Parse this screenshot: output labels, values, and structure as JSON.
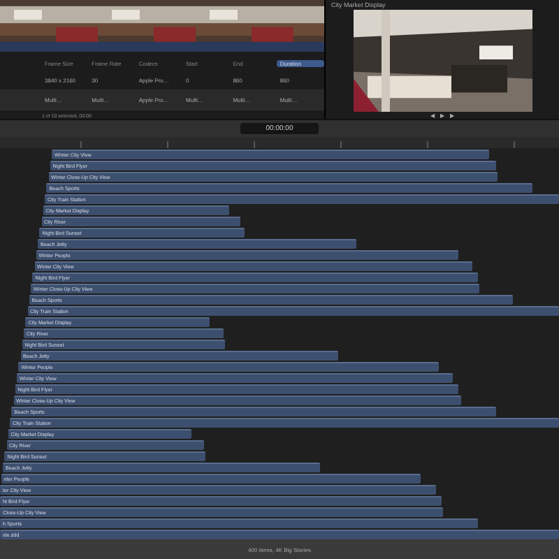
{
  "browser": {
    "columns": [
      {
        "label": "Frame Size",
        "selected": false
      },
      {
        "label": "Frame Rate",
        "selected": false
      },
      {
        "label": "Codecs",
        "selected": false
      },
      {
        "label": "Start",
        "selected": false
      },
      {
        "label": "End",
        "selected": false
      },
      {
        "label": "Duration",
        "selected": true
      }
    ],
    "rows": [
      [
        "3840 x 2160",
        "30",
        "Apple Pro…",
        "0",
        "860",
        "860"
      ],
      [
        "Multi…",
        "Multi…",
        "Apple Pro…",
        "Multi…",
        "Multi…",
        "Multi…"
      ]
    ],
    "selection_info": "1 of 10 selected, 00:00"
  },
  "viewer": {
    "title": "City Market Display",
    "controls": [
      "◀",
      "▶",
      "▶"
    ]
  },
  "toolbar": {
    "timecode": "00:00:00"
  },
  "clips": [
    {
      "name": "Winter City View"
    },
    {
      "name": "Night Bird Flyer"
    },
    {
      "name": "Winter Close-Up City View"
    },
    {
      "name": "Beach Sports"
    },
    {
      "name": "City Train Station"
    },
    {
      "name": "City Market Display"
    },
    {
      "name": "City River"
    },
    {
      "name": "Night Bird Sunset"
    },
    {
      "name": "Beach Jetty"
    },
    {
      "name": "Winter People"
    },
    {
      "name": "Winter City View"
    },
    {
      "name": "Night Bird Flyer"
    },
    {
      "name": "Winter Close-Up City View"
    },
    {
      "name": "Beach Sports"
    },
    {
      "name": "City Train Station"
    },
    {
      "name": "City Market Display"
    },
    {
      "name": "City River"
    },
    {
      "name": "Night Bird Sunset"
    },
    {
      "name": "Beach Jetty"
    },
    {
      "name": "Winter People"
    },
    {
      "name": "Winter City View"
    },
    {
      "name": "Night Bird Flyer"
    },
    {
      "name": "Winter Close-Up City View"
    },
    {
      "name": "Beach Sports"
    },
    {
      "name": "City Train Station"
    },
    {
      "name": "City Market Display"
    },
    {
      "name": "City River"
    },
    {
      "name": "Night Bird Sunset"
    },
    {
      "name": "Beach Jetty"
    },
    {
      "name": "nter People"
    },
    {
      "name": "ter City View"
    },
    {
      "name": "ht Bird Flyer"
    },
    {
      "name": "Close-Up City View"
    },
    {
      "name": "h Sports"
    },
    {
      "name": "ide.ddd"
    }
  ],
  "status_bar": "400 items, 4K Big Stories"
}
